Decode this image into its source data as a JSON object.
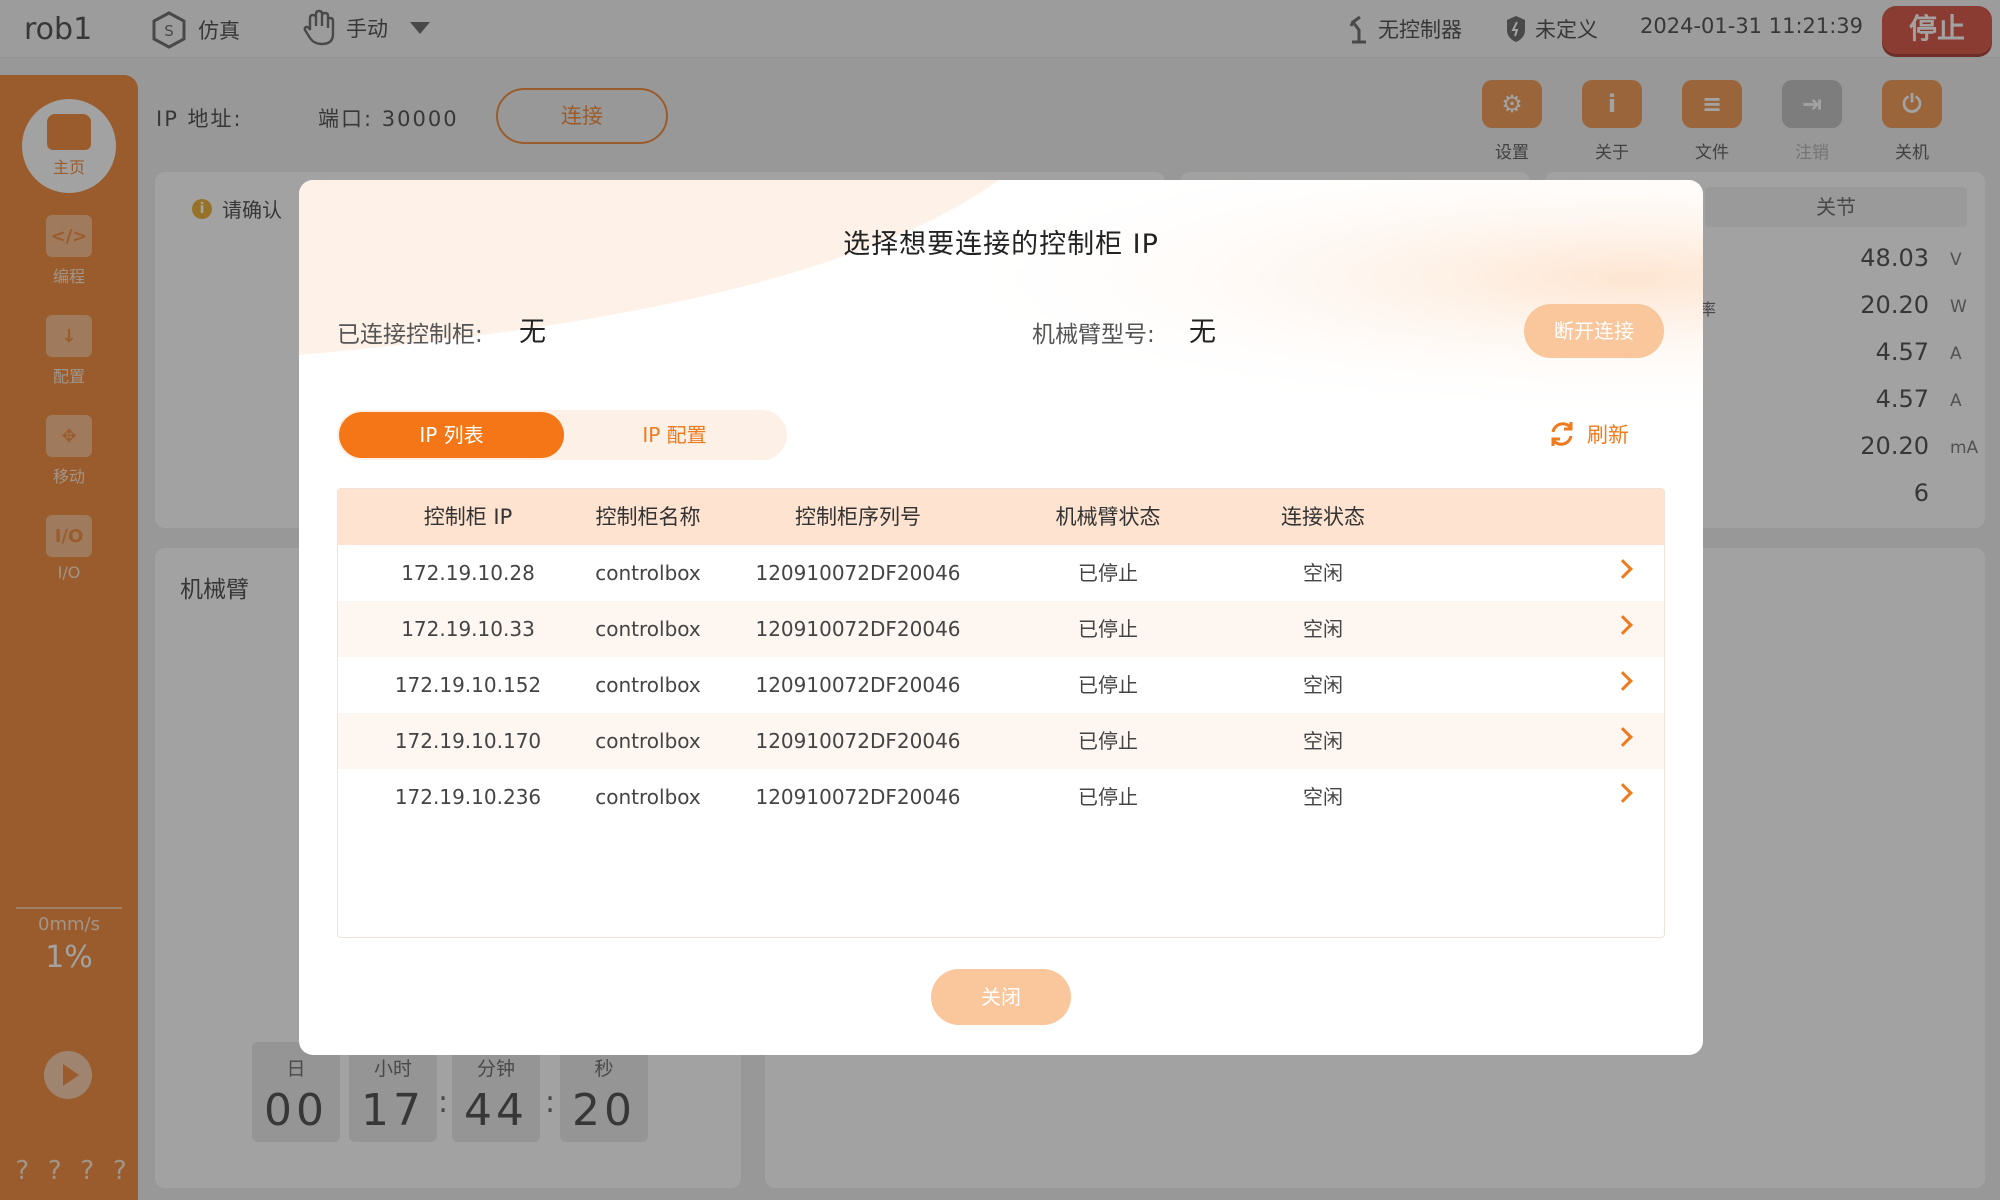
{
  "topbar": {
    "robot_name": "rob1",
    "mode_label": "仿真",
    "hand_mode_label": "手动",
    "controller_status": "无控制器",
    "safety_status": "未定义",
    "datetime": "2024-01-31 11:21:39",
    "stop_label": "停止"
  },
  "sidebar": {
    "home_label": "主页",
    "items": [
      {
        "label": "编程",
        "icon": "code-icon",
        "glyph": "</>"
      },
      {
        "label": "配置",
        "icon": "download-icon",
        "glyph": "↓"
      },
      {
        "label": "移动",
        "icon": "move-icon",
        "glyph": "✥"
      },
      {
        "label": "I/O",
        "icon": "io-icon",
        "glyph": "I/O"
      }
    ],
    "speed_percent": "1%",
    "speed_mms": "0mm/s",
    "footer_marks": [
      "?",
      "?",
      "?",
      "?"
    ]
  },
  "main": {
    "ip_label": "IP 地址:",
    "port_label": "端口: 30000",
    "connect_label": "连接",
    "toolbar": [
      {
        "label": "设置",
        "icon": "settings-icon",
        "glyph": "⚙"
      },
      {
        "label": "关于",
        "icon": "info-icon",
        "glyph": "i"
      },
      {
        "label": "文件",
        "icon": "file-icon",
        "glyph": "≡"
      },
      {
        "label": "注销",
        "icon": "logout-icon",
        "glyph": "⇥"
      },
      {
        "label": "关机",
        "icon": "power-icon",
        "glyph": "⏻"
      }
    ],
    "notice_text": "请确认",
    "arm_title": "机械臂",
    "joint_tab": "关节",
    "readings": [
      {
        "value": "48.03",
        "unit": "V"
      },
      {
        "value": "20.20",
        "unit": "W"
      },
      {
        "value": "4.57",
        "unit": "A"
      },
      {
        "value": "4.57",
        "unit": "A"
      },
      {
        "value": "20.20",
        "unit": "mA"
      },
      {
        "value": "6",
        "unit": ""
      }
    ],
    "rate_fragment": "率",
    "timer": [
      {
        "label": "日",
        "value": "00"
      },
      {
        "label": "小时",
        "value": "17"
      },
      {
        "label": "分钟",
        "value": "44"
      },
      {
        "label": "秒",
        "value": "20"
      }
    ]
  },
  "modal": {
    "title": "选择想要连接的控制柜 IP",
    "connected_label": "已连接控制柜:",
    "connected_value": "无",
    "model_label": "机械臂型号:",
    "model_value": "无",
    "disconnect_label": "断开连接",
    "tab_list": "IP 列表",
    "tab_config": "IP 配置",
    "refresh_label": "刷新",
    "headers": [
      "控制柜 IP",
      "控制柜名称",
      "控制柜序列号",
      "机械臂状态",
      "连接状态"
    ],
    "rows": [
      [
        "172.19.10.28",
        "controlbox",
        "120910072DF20046",
        "已停止",
        "空闲"
      ],
      [
        "172.19.10.33",
        "controlbox",
        "120910072DF20046",
        "已停止",
        "空闲"
      ],
      [
        "172.19.10.152",
        "controlbox",
        "120910072DF20046",
        "已停止",
        "空闲"
      ],
      [
        "172.19.10.170",
        "controlbox",
        "120910072DF20046",
        "已停止",
        "空闲"
      ],
      [
        "172.19.10.236",
        "controlbox",
        "120910072DF20046",
        "已停止",
        "空闲"
      ]
    ],
    "close_label": "关闭"
  },
  "colors": {
    "accent": "#f07a1e",
    "stop": "#d23a2a",
    "table_header": "#fde3d0"
  }
}
